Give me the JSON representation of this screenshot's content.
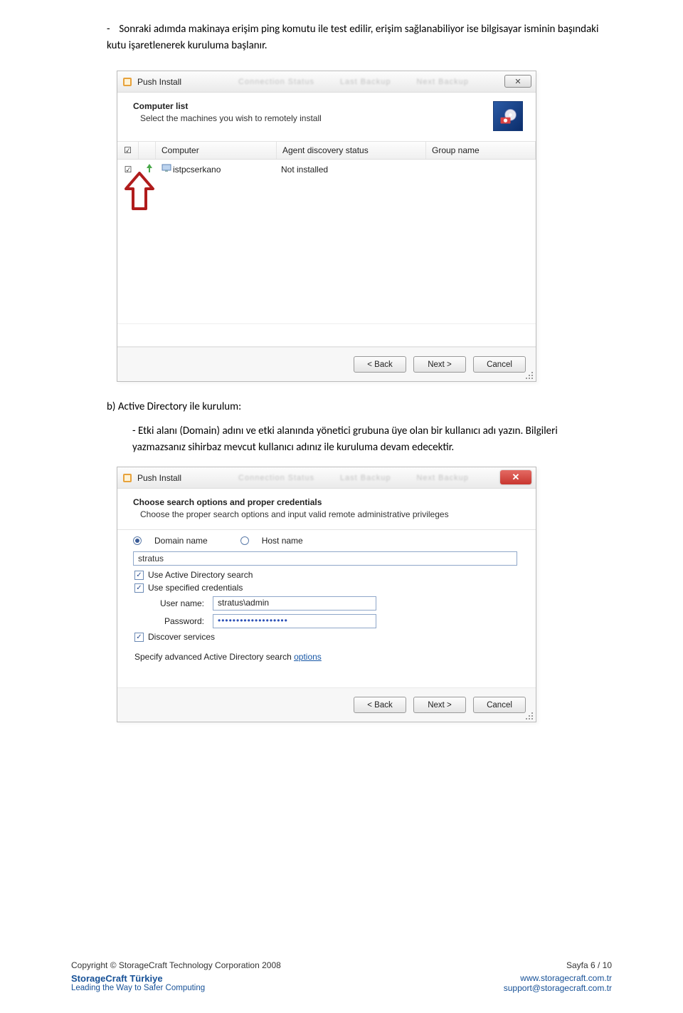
{
  "para1": "Sonraki adımda makinaya erişim ping komutu ile test edilir, erişim sağlanabiliyor ise bilgisayar isminin başındaki kutu işaretlenerek kuruluma başlanır.",
  "dialog1": {
    "title": "Push Install",
    "blur": [
      "Connection Status",
      "Last Backup",
      "Next Backup"
    ],
    "close": "✕",
    "heading": "Computer list",
    "sub": "Select the machines you wish to remotely install",
    "columns": {
      "checkbox": "☑",
      "computer": "Computer",
      "agent": "Agent discovery status",
      "group": "Group name"
    },
    "row": {
      "checked": "☑",
      "name": "istpcserkano",
      "status": "Not installed",
      "group": ""
    },
    "buttons": {
      "back": "< Back",
      "next": "Next >",
      "cancel": "Cancel"
    }
  },
  "section_b": "b)  Active Directory ile kurulum:",
  "para2": "Etki alanı (Domain) adını ve etki alanında yönetici grubuna üye olan bir kullanıcı adı yazın. Bilgileri yazmazsanız sihirbaz mevcut kullanıcı adınız ile kuruluma devam edecektir.",
  "dialog2": {
    "title": "Push Install",
    "heading": "Choose search options and proper credentials",
    "sub": "Choose the proper search options and input valid remote administrative privileges",
    "radio_domain": "Domain name",
    "radio_host": "Host name",
    "domain_value": "stratus",
    "chk_ad": "Use Active Directory search",
    "chk_cred": "Use specified credentials",
    "user_label": "User name:",
    "user_value": "stratus\\admin",
    "pass_label": "Password:",
    "pass_value": "•••••••••••••••••••",
    "chk_disc": "Discover services",
    "specify_pre": "Specify advanced Active Directory search ",
    "specify_link": "options",
    "buttons": {
      "back": "< Back",
      "next": "Next >",
      "cancel": "Cancel"
    }
  },
  "footer": {
    "copyright": "Copyright © StorageCraft Technology Corporation 2008",
    "brand": "StorageCraft Türkiye",
    "tagline": "Leading the Way to Safer Computing",
    "page": "Sayfa 6 / 10",
    "url": "www.storagecraft.com.tr",
    "email": "support@storagecraft.com.tr"
  }
}
